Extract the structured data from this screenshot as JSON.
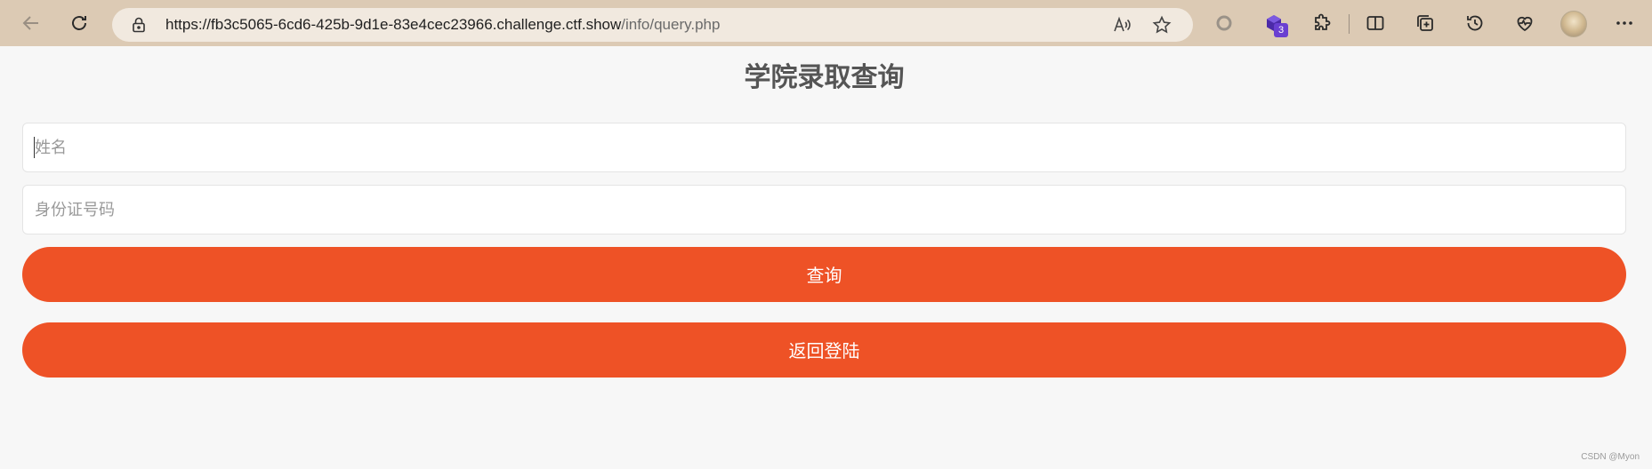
{
  "browser": {
    "url_host": "https://fb3c5065-6cd6-425b-9d1e-83e4cec23966.challenge.ctf.show",
    "url_path": "/info/query.php",
    "extensions_badge": "3"
  },
  "page": {
    "title": "学院录取查询",
    "name_placeholder": "姓名",
    "id_placeholder": "身份证号码",
    "query_label": "查询",
    "back_label": "返回登陆",
    "watermark": "CSDN @Myon⁠⁠"
  },
  "colors": {
    "accent": "#ee5226",
    "chrome": "#dccab4"
  }
}
